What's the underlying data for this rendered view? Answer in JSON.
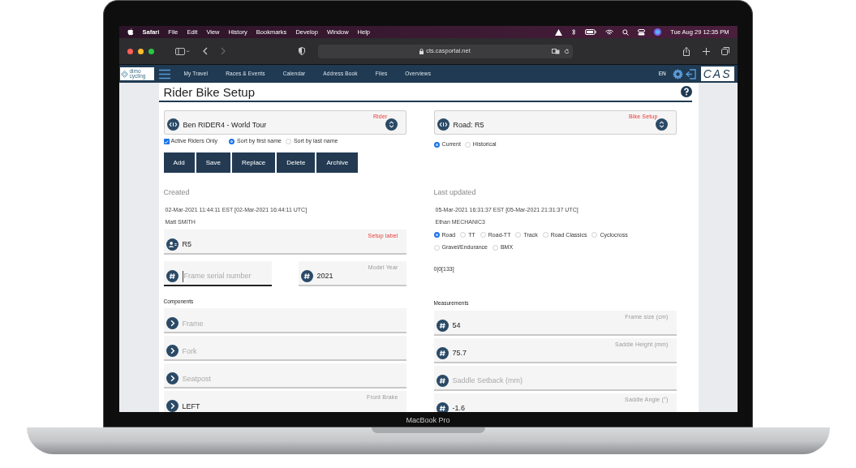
{
  "laptop": {
    "label": "MacBook Pro"
  },
  "menubar": {
    "app": "Safari",
    "items": [
      "File",
      "Edit",
      "View",
      "History",
      "Bookmarks",
      "Develop",
      "Window",
      "Help"
    ],
    "date_time": "Tue Aug 29  12:35 PM"
  },
  "browser": {
    "url": "cts.casportal.net"
  },
  "nav": {
    "logo_lines": [
      "dimo",
      "cycling"
    ],
    "items": [
      "My Travel",
      "Races & Events",
      "Calendar",
      "Address Book",
      "Files",
      "Overviews"
    ],
    "language": "EN",
    "brand": "CAS"
  },
  "page": {
    "title": "Rider Bike Setup"
  },
  "rider_select": {
    "label": "Rider",
    "value": "Ben RIDER4 - World Tour"
  },
  "active_only": {
    "label": "Active Riders Only",
    "checked": true
  },
  "sort_options": [
    {
      "label": "Sort by first name",
      "selected": true
    },
    {
      "label": "Sort by last name",
      "selected": false
    }
  ],
  "buttons": [
    "Add",
    "Save",
    "Replace",
    "Delete",
    "Archive"
  ],
  "bike_select": {
    "label": "Bike Setup",
    "value": "Road: R5"
  },
  "period_options": [
    {
      "label": "Current",
      "selected": true
    },
    {
      "label": "Historical",
      "selected": false
    }
  ],
  "created": {
    "heading": "Created",
    "timestamp": "02-Mar-2021 11:44:11 EST [02-Mar-2021 16:44:11 UTC]",
    "user": "Matt SMITH"
  },
  "last_updated": {
    "heading": "Last updated",
    "timestamp": "05-Mar-2021 16:31:37 EST [05-Mar-2021 21:31:37 UTC]",
    "user": "Ethan MECHANIC3"
  },
  "setup_label": {
    "label": "Setup label",
    "value": "R5",
    "required": true
  },
  "bike_types": [
    {
      "label": "Road",
      "selected": true
    },
    {
      "label": "TT",
      "selected": false
    },
    {
      "label": "Road-TT",
      "selected": false
    },
    {
      "label": "Track",
      "selected": false
    },
    {
      "label": "Road Classics",
      "selected": false
    },
    {
      "label": "Cyclocross",
      "selected": false
    },
    {
      "label": "Gravel/Endurance",
      "selected": false
    },
    {
      "label": "BMX",
      "selected": false
    }
  ],
  "frame_serial": {
    "placeholder": "Frame serial number"
  },
  "model_year": {
    "label": "Model Year",
    "value": "2021"
  },
  "code": "0|0[133]",
  "components": {
    "heading": "Components",
    "items": [
      {
        "placeholder": "Frame"
      },
      {
        "placeholder": "Fork"
      },
      {
        "placeholder": "Seatpost"
      },
      {
        "label": "Front Brake",
        "value": "LEFT"
      }
    ]
  },
  "measurements": {
    "heading": "Measurements",
    "items": [
      {
        "label": "Frame size (cm)",
        "value": "54"
      },
      {
        "label": "Saddle Height (mm)",
        "value": "75.7"
      },
      {
        "placeholder": "Saddle Setback (mm)"
      },
      {
        "label": "Saddle Angle (°)",
        "value": "-1.6"
      }
    ]
  }
}
